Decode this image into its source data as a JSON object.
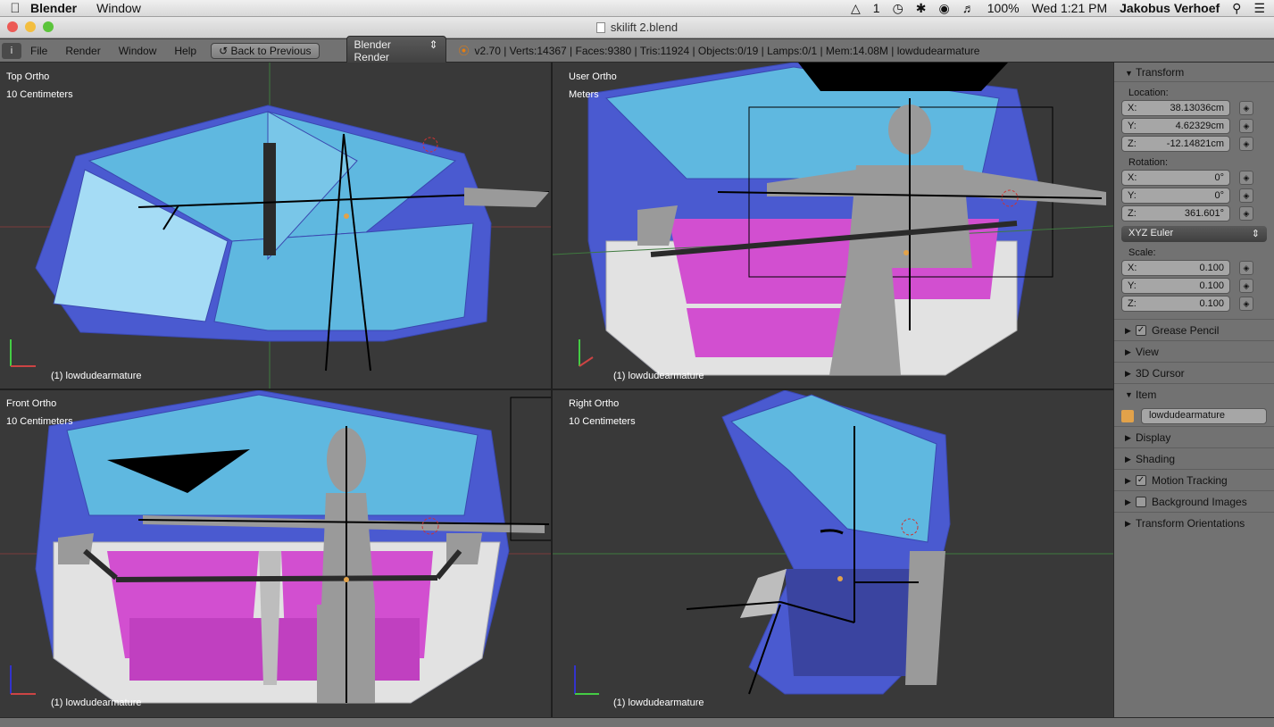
{
  "menubar": {
    "app": "Blender",
    "items": [
      "Window"
    ],
    "status": {
      "a1": "1",
      "battery": "100%",
      "clock": "Wed 1:21 PM",
      "user": "Jakobus Verhoef"
    }
  },
  "window": {
    "title": "skilift 2.blend"
  },
  "infobar": {
    "menus": [
      "File",
      "Render",
      "Window",
      "Help"
    ],
    "back_label": "Back to Previous",
    "engine": "Blender Render",
    "stats": "v2.70 | Verts:14367 | Faces:9380 | Tris:11924 | Objects:0/19 | Lamps:0/1 | Mem:14.08M | lowdudearmature"
  },
  "viewports": [
    {
      "view": "Top Ortho",
      "scale": "10 Centimeters",
      "object": "(1) lowdudearmature"
    },
    {
      "view": "User Ortho",
      "scale": "Meters",
      "object": "(1) lowdudearmature"
    },
    {
      "view": "Front Ortho",
      "scale": "10 Centimeters",
      "object": "(1) lowdudearmature"
    },
    {
      "view": "Right Ortho",
      "scale": "10 Centimeters",
      "object": "(1) lowdudearmature"
    }
  ],
  "npanel": {
    "transform": "Transform",
    "location_label": "Location:",
    "location": [
      {
        "axis": "X:",
        "value": "38.13036cm"
      },
      {
        "axis": "Y:",
        "value": "4.62329cm"
      },
      {
        "axis": "Z:",
        "value": "-12.14821cm"
      }
    ],
    "rotation_label": "Rotation:",
    "rotation": [
      {
        "axis": "X:",
        "value": "0°"
      },
      {
        "axis": "Y:",
        "value": "0°"
      },
      {
        "axis": "Z:",
        "value": "361.601°"
      }
    ],
    "rotation_mode": "XYZ Euler",
    "scale_label": "Scale:",
    "scale": [
      {
        "axis": "X:",
        "value": "0.100"
      },
      {
        "axis": "Y:",
        "value": "0.100"
      },
      {
        "axis": "Z:",
        "value": "0.100"
      }
    ],
    "sections": {
      "grease_pencil": "Grease Pencil",
      "view": "View",
      "cursor": "3D Cursor",
      "item": "Item",
      "item_name": "lowdudearmature",
      "display": "Display",
      "shading": "Shading",
      "motion_tracking": "Motion Tracking",
      "background_images": "Background Images",
      "transform_orientations": "Transform Orientations"
    }
  },
  "colors": {
    "viewport_bg": "#393939",
    "panel_bg": "#727272",
    "glass": "#5fb8e0",
    "frame": "#4a5ad0",
    "seat": "#d24fd0"
  }
}
